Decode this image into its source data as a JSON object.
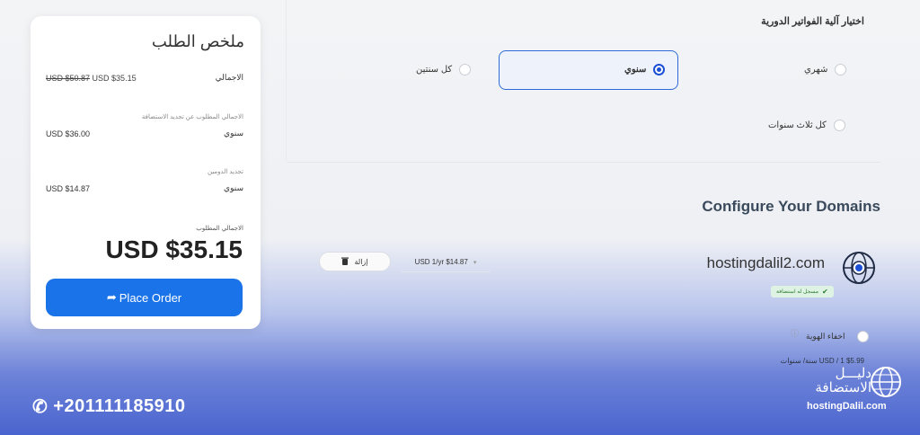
{
  "summary": {
    "title": "ملخص الطلب",
    "subtotal_label": "الاجمالي",
    "subtotal_old": "USD $50.87",
    "subtotal_new": "USD $35.15",
    "recurring_label": "الاجمالي المطلوب عن تجديد الاستضافة",
    "recurring_cycle": "سنوي",
    "recurring_value": "USD $36.00",
    "domain_renew_label": "تجديد الدومين",
    "domain_renew_cycle": "سنوي",
    "domain_renew_value": "USD $14.87",
    "total_label": "الاجمالي المطلوب",
    "total_value": "USD $35.15",
    "place_order": "Place Order"
  },
  "billing": {
    "title": "اختيار آلية الفواتير الدورية",
    "options": [
      {
        "label": "شهري",
        "selected": false
      },
      {
        "label": "سنوي",
        "selected": true
      },
      {
        "label": "كل سنتين",
        "selected": false
      },
      {
        "label": "كل ثلاث سنوات",
        "selected": false
      }
    ]
  },
  "domains": {
    "title": "Configure Your Domains",
    "domain": "hostingdalil2.com",
    "badge": "مسجل له استضافة",
    "price": "USD 1/yr $14.87",
    "remove": "إزالة",
    "privacy_label": "اخفاء الهوية",
    "privacy_price": "USD / 1 $5.99 سنة/ سنوات"
  },
  "footer": {
    "phone": "+201111185910",
    "logo_ar": "دليـــل الاستضافة",
    "logo_en": "hostingDalil.com"
  },
  "colors": {
    "accent": "#1a73e8",
    "selected_border": "#2d6ad8",
    "badge_bg": "#dff3e4"
  }
}
